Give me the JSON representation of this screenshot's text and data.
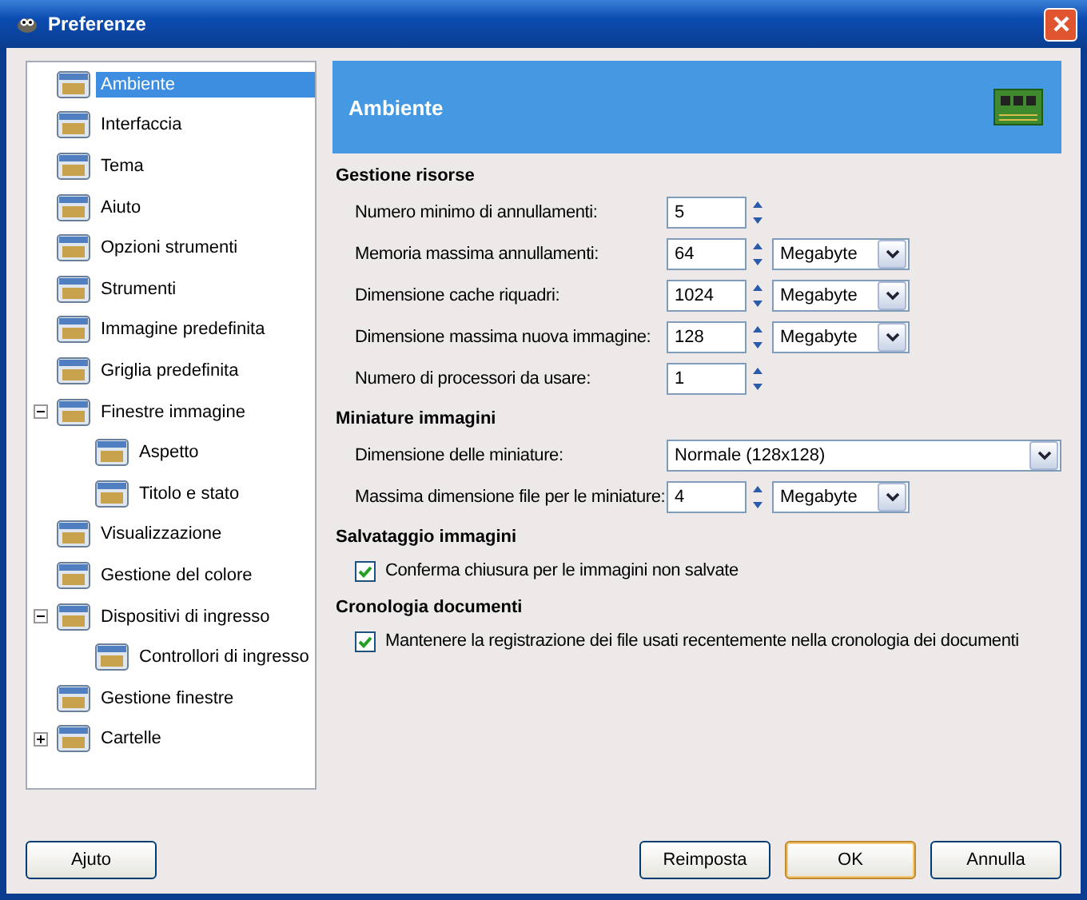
{
  "window": {
    "title": "Preferenze"
  },
  "sidebar": {
    "items": [
      {
        "label": "Ambiente",
        "selected": true
      },
      {
        "label": "Interfaccia",
        "selected": false
      },
      {
        "label": "Tema",
        "selected": false
      },
      {
        "label": "Aiuto",
        "selected": false
      },
      {
        "label": "Opzioni strumenti",
        "selected": false
      },
      {
        "label": "Strumenti",
        "selected": false
      },
      {
        "label": "Immagine predefinita",
        "selected": false
      },
      {
        "label": "Griglia predefinita",
        "selected": false
      },
      {
        "label": "Finestre immagine",
        "selected": false,
        "expanded": true,
        "children": [
          {
            "label": "Aspetto",
            "selected": false
          },
          {
            "label": "Titolo e stato",
            "selected": false
          }
        ]
      },
      {
        "label": "Visualizzazione",
        "selected": false
      },
      {
        "label": "Gestione del colore",
        "selected": false
      },
      {
        "label": "Dispositivi di ingresso",
        "selected": false,
        "expanded": true,
        "children": [
          {
            "label": "Controllori di ingresso",
            "selected": false
          }
        ]
      },
      {
        "label": "Gestione finestre",
        "selected": false
      },
      {
        "label": "Cartelle",
        "selected": false,
        "expanded": false
      }
    ]
  },
  "header": {
    "title": "Ambiente"
  },
  "sections": [
    {
      "title": "Gestione risorse",
      "rows": [
        {
          "kind": "spin",
          "label": "Numero minimo di annullamenti:",
          "value": "5"
        },
        {
          "kind": "spin",
          "label": "Memoria massima annullamenti:",
          "value": "64",
          "unit": "Megabyte"
        },
        {
          "kind": "spin",
          "label": "Dimensione cache riquadri:",
          "value": "1024",
          "unit": "Megabyte"
        },
        {
          "kind": "spin",
          "label": "Dimensione massima nuova immagine:",
          "value": "128",
          "unit": "Megabyte"
        },
        {
          "kind": "spin",
          "label": "Numero di processori da usare:",
          "value": "1"
        }
      ]
    },
    {
      "title": "Miniature immagini",
      "rows": [
        {
          "kind": "combo",
          "label": "Dimensione delle miniature:",
          "value": "Normale (128x128)"
        },
        {
          "kind": "spin",
          "label": "Massima dimensione file per le miniature:",
          "value": "4",
          "unit": "Megabyte"
        }
      ]
    },
    {
      "title": "Salvataggio immagini",
      "rows": [
        {
          "kind": "checkbox",
          "label": "Conferma chiusura per le immagini non salvate",
          "checked": true
        }
      ]
    },
    {
      "title": "Cronologia documenti",
      "rows": [
        {
          "kind": "checkbox",
          "label": "Mantenere la registrazione dei file usati recentemente nella cronologia dei documenti",
          "checked": true
        }
      ]
    }
  ],
  "buttons": {
    "left": [
      "Ajuto"
    ],
    "right": [
      {
        "label": "Reimposta",
        "default": false
      },
      {
        "label": "OK",
        "default": true
      },
      {
        "label": "Annulla",
        "default": false
      }
    ]
  }
}
